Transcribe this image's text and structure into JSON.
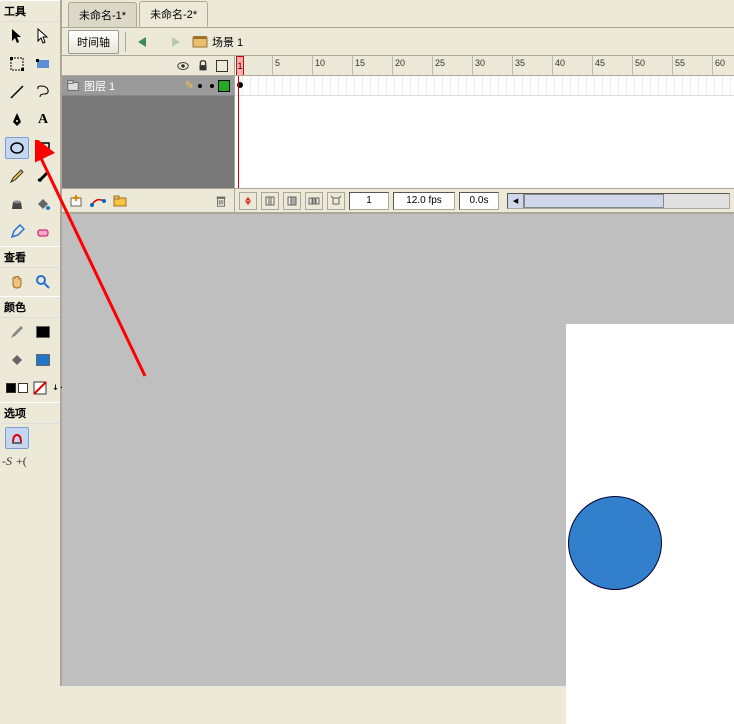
{
  "tools_panel": {
    "title": "工具",
    "view_title": "查看",
    "colors_title": "颜色",
    "options_title": "选项"
  },
  "tabs": {
    "tab1": "未命名-1*",
    "tab2": "未命名-2*"
  },
  "controls": {
    "timeline_btn": "时间轴",
    "scene_label": "场景 1"
  },
  "ruler_ticks": [
    "1",
    "5",
    "10",
    "15",
    "20",
    "25",
    "30",
    "35",
    "40",
    "45",
    "50",
    "55",
    "60"
  ],
  "layer": {
    "name": "图层 1"
  },
  "status": {
    "current_frame": "1",
    "fps": "12.0 fps",
    "time": "0.0s"
  },
  "options": {
    "snap1": "-S",
    "snap2": "+("
  }
}
